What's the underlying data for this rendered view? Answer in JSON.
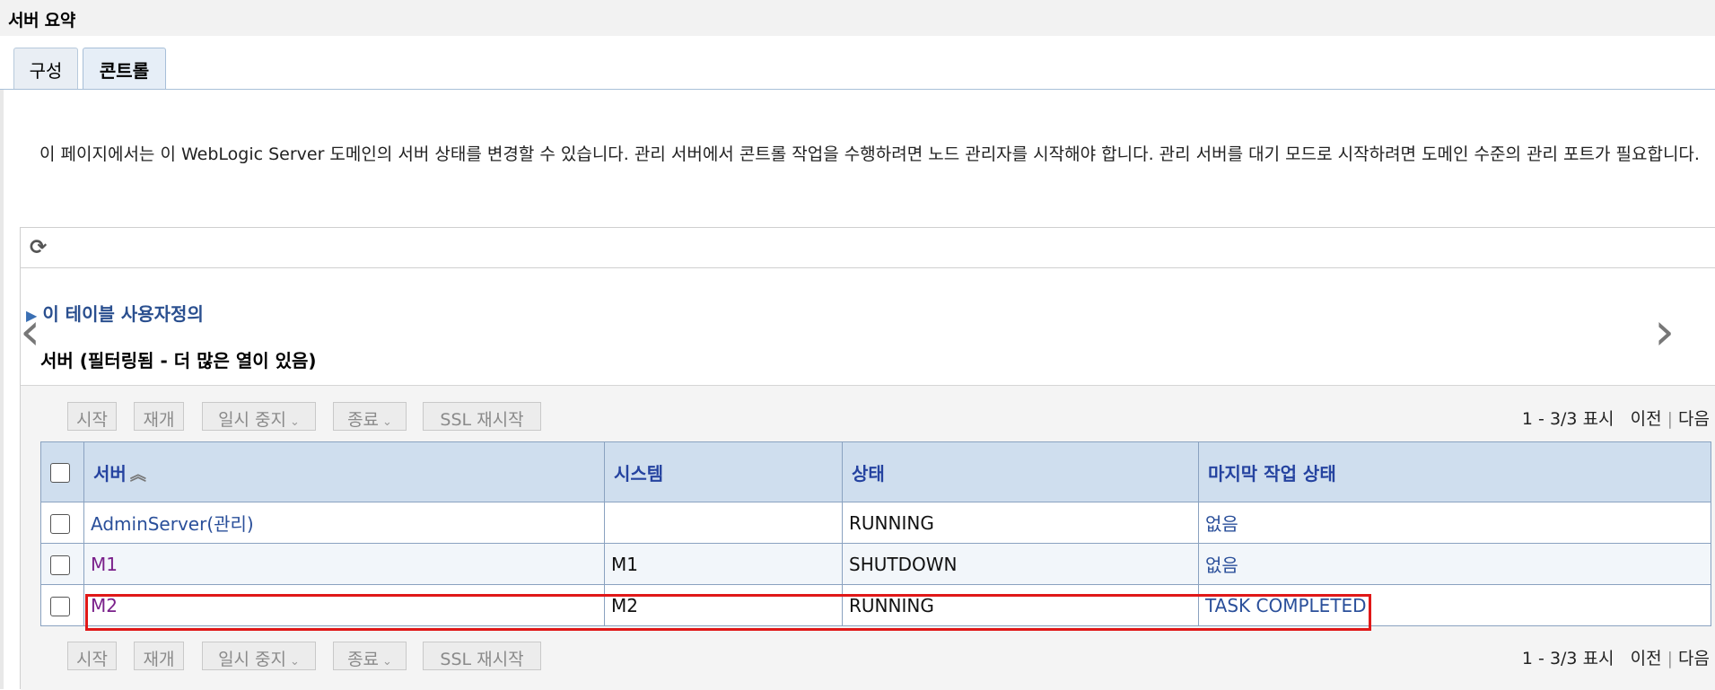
{
  "header": {
    "title": "서버 요약"
  },
  "tabs": [
    {
      "label": "구성",
      "active": false
    },
    {
      "label": "콘트롤",
      "active": true
    }
  ],
  "description": "이 페이지에서는 이 WebLogic Server 도메인의 서버 상태를 변경할 수 있습니다. 관리 서버에서 콘트롤 작업을 수행하려면 노드 관리자를 시작해야 합니다. 관리 서버를 대기 모드로 시작하려면 도메인 수준의 관리 포트가 필요합니다.",
  "customize_link": "이 테이블 사용자정의",
  "table_caption": "서버 (필터링됨 - 더 많은 열이 있음)",
  "buttons": {
    "start": "시작",
    "resume": "재개",
    "suspend": "일시 중지",
    "shutdown": "종료",
    "ssl_restart": "SSL 재시작"
  },
  "pager": {
    "range": "1 - 3/3 표시",
    "prev": "이전",
    "next": "다음"
  },
  "columns": [
    "서버",
    "시스템",
    "상태",
    "마지막 작업 상태"
  ],
  "rows": [
    {
      "server": "AdminServer(관리)",
      "machine": "",
      "state": "RUNNING",
      "last_task": "없음"
    },
    {
      "server": "M1",
      "machine": "M1",
      "state": "SHUTDOWN",
      "last_task": "없음"
    },
    {
      "server": "M2",
      "machine": "M2",
      "state": "RUNNING",
      "last_task": "TASK COMPLETED"
    }
  ],
  "icons": {
    "refresh": "refresh-icon",
    "expand": "triangle-right-icon",
    "sort": "sort-ascending-icon",
    "nav_prev": "chevron-left-icon",
    "nav_next": "chevron-right-icon"
  },
  "colors": {
    "highlight": "#e01818",
    "header_bg": "#cfdeee",
    "link": "#2a4f9a"
  }
}
